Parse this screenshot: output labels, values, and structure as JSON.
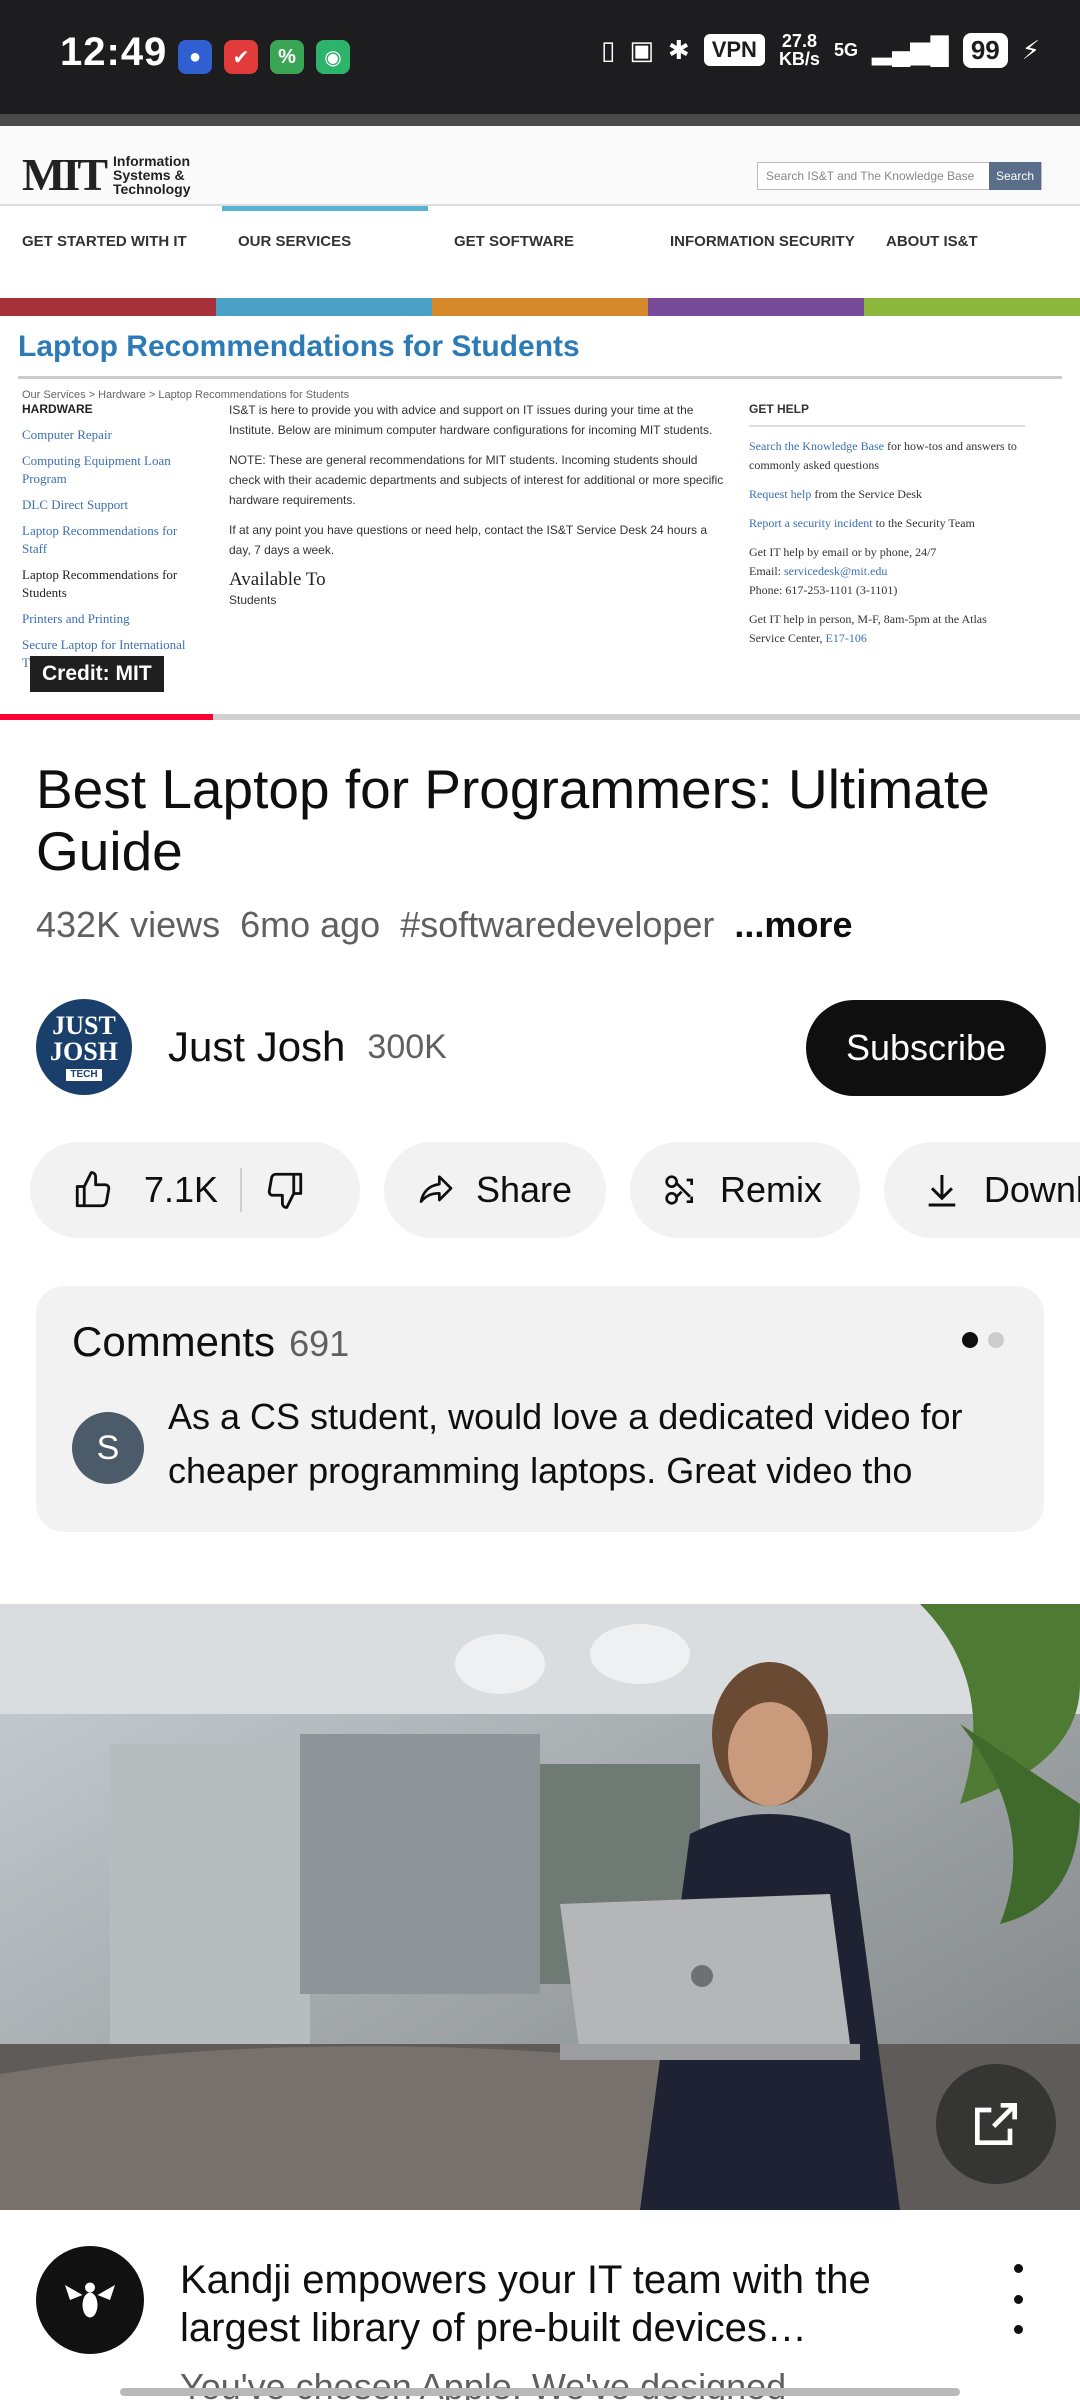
{
  "status_bar": {
    "time": "12:49",
    "vpn": "VPN",
    "speed_value": "27.8",
    "speed_unit": "KB/s",
    "network": "5G",
    "battery": "99"
  },
  "video": {
    "credit": "Credit: MIT",
    "progress": 0.197,
    "webpage": {
      "logo_text": "Information Systems & Technology",
      "search_placeholder": "Search IS&T and The Knowledge Base",
      "search_button": "Search",
      "nav": [
        "Get Started with IT",
        "Our Services",
        "Get Software",
        "Information Security",
        "About IS&T"
      ],
      "color_bar": [
        "#a6313a",
        "#4aa3c7",
        "#d4882a",
        "#7a4a9a",
        "#8bb83c"
      ],
      "heading": "Laptop Recommendations for Students",
      "breadcrumb": "Our Services > Hardware > Laptop Recommendations for Students",
      "sidebar_heading": "HARDWARE",
      "sidebar_links": [
        "Computer Repair",
        "Computing Equipment Loan Program",
        "DLC Direct Support",
        "Laptop Recommendations for Staff"
      ],
      "sidebar_current": "Laptop Recommendations for Students",
      "sidebar_more": [
        "Printers and Printing",
        "Secure Laptop for International Travel"
      ],
      "body_p1": "IS&T is here to provide you with advice and support on IT issues during your time at the Institute. Below are minimum computer hardware configurations for incoming MIT students.",
      "body_p2": "NOTE: These are general recommendations for MIT students. Incoming students should check with their academic departments and subjects of interest for additional or more specific hardware requirements.",
      "body_p3": "If at any point you have questions or need help, contact the IS&T Service Desk 24 hours a day, 7 days a week.",
      "available_heading": "Available To",
      "available_value": "Students",
      "help_heading": "GET HELP",
      "help_1_link": "Search the Knowledge Base",
      "help_1_text": " for how-tos and answers to commonly asked questions",
      "help_2_link": "Request help",
      "help_2_text": " from the Service Desk",
      "help_3_link": "Report a security incident",
      "help_3_text": " to the Security Team",
      "help_4": "Get IT help by email or by phone, 24/7",
      "help_5_label": "Email: ",
      "help_5_link": "servicedesk@mit.edu",
      "help_6": "Phone: 617-253-1101 (3-1101)",
      "help_7": "Get IT help in person, M-F, 8am-5pm at the Atlas Service Center, ",
      "help_7_link": "E17-106"
    }
  },
  "details": {
    "title": "Best Laptop for Programmers: Ultimate Guide",
    "views": "432K views",
    "age": "6mo ago",
    "hashtag": "#softwaredeveloper",
    "more": "...more"
  },
  "channel": {
    "avatar_line1": "JUST",
    "avatar_line2": "JOSH",
    "avatar_tag": "TECH",
    "name": "Just Josh",
    "subscribers": "300K",
    "subscribe_label": "Subscribe"
  },
  "actions": {
    "likes": "7.1K",
    "share": "Share",
    "remix": "Remix",
    "download": "Download"
  },
  "comments": {
    "label": "Comments",
    "count": "691",
    "avatar_initial": "S",
    "top_comment": "As a CS student, would love a dedicated video for cheaper programming laptops. Great video tho"
  },
  "ad": {
    "title": "Kandji empowers your IT team with the largest library of pre-built devices…",
    "subtitle": "You've chosen Apple. We've designed"
  }
}
